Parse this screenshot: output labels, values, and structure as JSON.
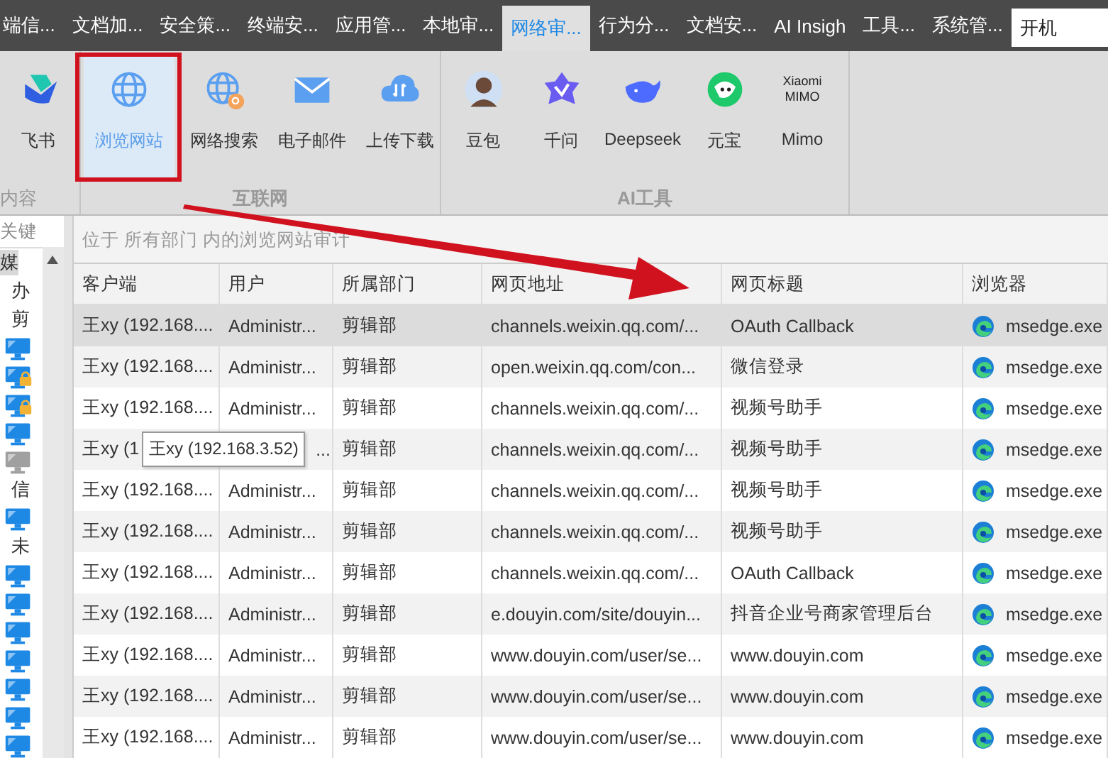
{
  "tabs": [
    {
      "label": "端信...",
      "selected": false
    },
    {
      "label": "文档加...",
      "selected": false
    },
    {
      "label": "安全策...",
      "selected": false
    },
    {
      "label": "终端安...",
      "selected": false
    },
    {
      "label": "应用管...",
      "selected": false
    },
    {
      "label": "本地审...",
      "selected": false
    },
    {
      "label": "网络审...",
      "selected": true
    },
    {
      "label": "行为分...",
      "selected": false
    },
    {
      "label": "文档安...",
      "selected": false
    },
    {
      "label": "AI Insigh",
      "selected": false
    },
    {
      "label": "工具...",
      "selected": false
    },
    {
      "label": "系统管...",
      "selected": false
    }
  ],
  "search": {
    "value": "开机"
  },
  "ribbon": {
    "groups": [
      {
        "label": "内容",
        "items": [
          {
            "kind": "feishu",
            "label": "飞书",
            "selected": false
          }
        ]
      },
      {
        "label": "互联网",
        "items": [
          {
            "kind": "globe",
            "label": "浏览网站",
            "selected": true
          },
          {
            "kind": "globe-search",
            "label": "网络搜索",
            "selected": false
          },
          {
            "kind": "mail",
            "label": "电子邮件",
            "selected": false
          },
          {
            "kind": "cloud",
            "label": "上传下载",
            "selected": false
          }
        ]
      },
      {
        "label": "AI工具",
        "items": [
          {
            "kind": "avatar",
            "label": "豆包",
            "selected": false
          },
          {
            "kind": "star",
            "label": "千问",
            "selected": false
          },
          {
            "kind": "whale",
            "label": "Deepseek",
            "selected": false
          },
          {
            "kind": "yuanbao",
            "label": "元宝",
            "selected": false
          },
          {
            "kind": "wordmark",
            "logo": [
              "Xiaomi",
              "MIMO"
            ],
            "label": "Mimo",
            "selected": false
          }
        ]
      }
    ]
  },
  "sidebar": {
    "search": {
      "value": "关键"
    },
    "tree": [
      {
        "kind": "group",
        "label": "媒",
        "selected": true,
        "children": [
          {
            "kind": "group",
            "label": "办",
            "selected": false
          },
          {
            "kind": "group",
            "label": "剪",
            "selected": false,
            "children": [
              {
                "kind": "computer",
                "online": true,
                "locked": false
              },
              {
                "kind": "computer",
                "online": true,
                "locked": true
              },
              {
                "kind": "computer",
                "online": true,
                "locked": true
              },
              {
                "kind": "computer",
                "online": true,
                "locked": false
              },
              {
                "kind": "computer",
                "online": false,
                "locked": false
              }
            ]
          },
          {
            "kind": "group",
            "label": "信",
            "selected": false,
            "children": [
              {
                "kind": "computer",
                "online": true,
                "locked": false
              }
            ]
          },
          {
            "kind": "group",
            "label": "未",
            "selected": false,
            "children": [
              {
                "kind": "computer",
                "online": true,
                "locked": false
              },
              {
                "kind": "computer",
                "online": true,
                "locked": false
              },
              {
                "kind": "computer",
                "online": true,
                "locked": false
              },
              {
                "kind": "computer",
                "online": true,
                "locked": false
              },
              {
                "kind": "computer",
                "online": true,
                "locked": false
              },
              {
                "kind": "computer",
                "online": true,
                "locked": false
              },
              {
                "kind": "computer",
                "online": true,
                "locked": false
              }
            ]
          }
        ]
      }
    ]
  },
  "breadcrumb": "位于 所有部门 内的浏览网站审计",
  "table": {
    "columns": [
      "客户端",
      "用户",
      "所属部门",
      "网页地址",
      "网页标题",
      "浏览器"
    ],
    "rows": [
      {
        "selected": true,
        "cells": [
          "王xy (192.168....",
          "Administr...",
          "剪辑部",
          "channels.weixin.qq.com/...",
          "OAuth Callback",
          "msedge.exe"
        ]
      },
      {
        "selected": false,
        "cells": [
          "王xy (192.168....",
          "Administr...",
          "剪辑部",
          "open.weixin.qq.com/con...",
          "微信登录",
          "msedge.exe"
        ]
      },
      {
        "selected": false,
        "cells": [
          "王xy (192.168....",
          "Administr...",
          "剪辑部",
          "channels.weixin.qq.com/...",
          "视频号助手",
          "msedge.exe"
        ]
      },
      {
        "selected": false,
        "tooltip": "王xy (192.168.3.52)",
        "cells": [
          "王xy (1",
          "...",
          "剪辑部",
          "channels.weixin.qq.com/...",
          "视频号助手",
          "msedge.exe"
        ]
      },
      {
        "selected": false,
        "cells": [
          "王xy (192.168....",
          "Administr...",
          "剪辑部",
          "channels.weixin.qq.com/...",
          "视频号助手",
          "msedge.exe"
        ]
      },
      {
        "selected": false,
        "cells": [
          "王xy (192.168....",
          "Administr...",
          "剪辑部",
          "channels.weixin.qq.com/...",
          "视频号助手",
          "msedge.exe"
        ]
      },
      {
        "selected": false,
        "cells": [
          "王xy (192.168....",
          "Administr...",
          "剪辑部",
          "channels.weixin.qq.com/...",
          "OAuth Callback",
          "msedge.exe"
        ]
      },
      {
        "selected": false,
        "cells": [
          "王xy (192.168....",
          "Administr...",
          "剪辑部",
          "e.douyin.com/site/douyin...",
          "抖音企业号商家管理后台",
          "msedge.exe"
        ]
      },
      {
        "selected": false,
        "cells": [
          "王xy (192.168....",
          "Administr...",
          "剪辑部",
          "www.douyin.com/user/se...",
          "www.douyin.com",
          "msedge.exe"
        ]
      },
      {
        "selected": false,
        "cells": [
          "王xy (192.168....",
          "Administr...",
          "剪辑部",
          "www.douyin.com/user/se...",
          "www.douyin.com",
          "msedge.exe"
        ]
      },
      {
        "selected": false,
        "cells": [
          "王xy (192.168....",
          "Administr...",
          "剪辑部",
          "www.douyin.com/user/se...",
          "www.douyin.com",
          "msedge.exe"
        ]
      }
    ]
  }
}
